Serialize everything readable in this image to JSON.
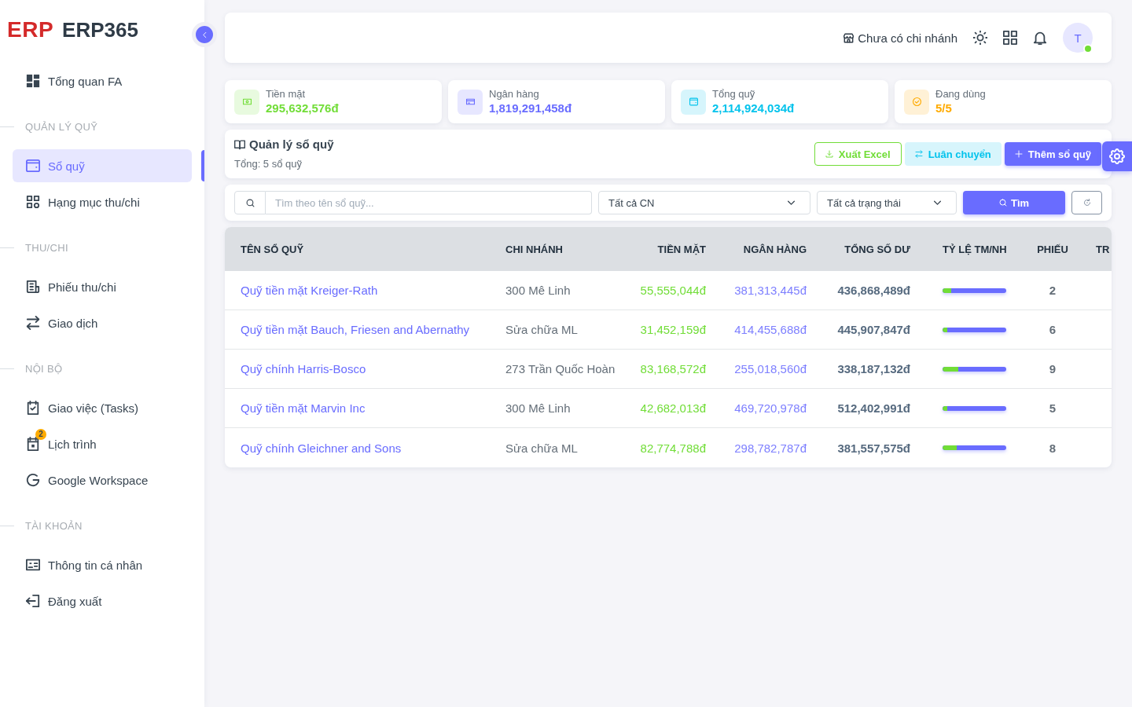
{
  "sidebar": {
    "logo": {
      "mark": "ERP",
      "name": "ERP365"
    },
    "nav": [
      {
        "kind": "link",
        "label": "Tổng quan FA",
        "selected": false
      },
      {
        "kind": "heading",
        "label": "QUẢN LÝ QUỸ"
      },
      {
        "kind": "link",
        "label": "Sổ quỹ",
        "selected": true
      },
      {
        "kind": "link",
        "label": "Hạng mục thu/chi",
        "selected": false
      },
      {
        "kind": "heading",
        "label": "THU/CHI"
      },
      {
        "kind": "link",
        "label": "Phiếu thu/chi",
        "selected": false
      },
      {
        "kind": "link",
        "label": "Giao dịch",
        "selected": false
      },
      {
        "kind": "heading",
        "label": "NỘI BỘ"
      },
      {
        "kind": "link",
        "label": "Giao việc (Tasks)",
        "selected": false
      },
      {
        "kind": "link",
        "label": "Lịch trình",
        "selected": false,
        "badge": "2"
      },
      {
        "kind": "link",
        "label": "Google Workspace",
        "selected": false
      },
      {
        "kind": "heading",
        "label": "TÀI KHOẢN"
      },
      {
        "kind": "link",
        "label": "Thông tin cá nhân",
        "selected": false
      },
      {
        "kind": "link",
        "label": "Đăng xuất",
        "selected": false
      }
    ]
  },
  "topbar": {
    "branch": "Chưa có chi nhánh",
    "avatar": {
      "initial": "T",
      "online": true
    }
  },
  "stats": [
    {
      "label": "Tiền mặt",
      "value": "295,632,576đ",
      "color": "#71dd37"
    },
    {
      "label": "Ngân hàng",
      "value": "1,819,291,458đ",
      "color": "#696cff"
    },
    {
      "label": "Tổng quỹ",
      "value": "2,114,924,034đ",
      "color": "#03c3ec"
    },
    {
      "label": "Đang dùng",
      "value": "5/5",
      "color": "#ffab00"
    }
  ],
  "fund_panel": {
    "title": "Quản lý sổ quỹ",
    "subtitle": "Tổng: 5 sổ quỹ",
    "actions": [
      {
        "kind": "outline",
        "label": "Xuất Excel"
      },
      {
        "kind": "soft",
        "label": "Luân chuyển"
      },
      {
        "kind": "primary",
        "label": "Thêm sổ quỹ"
      }
    ]
  },
  "filters": {
    "search": {
      "placeholder": "Tìm theo tên sổ quỹ..."
    },
    "selects": [
      {
        "value": "Tất cả CN"
      },
      {
        "value": "Tất cả trạng thái"
      }
    ],
    "search_button": "Tìm"
  },
  "table": {
    "columns": [
      "TÊN SỔ QUỸ",
      "CHI NHÁNH",
      "TIỀN MẶT",
      "NGÂN HÀNG",
      "TỔNG SỐ DƯ",
      "TỶ LỆ TM/NH",
      "PHIẾU",
      "TR"
    ],
    "rows": [
      {
        "name": "Quỹ tiền mặt Kreiger-Rath",
        "branch": "300 Mê Linh",
        "cash": "55,555,044đ",
        "bank": "381,313,445đ",
        "total": "436,868,489đ",
        "ratio": {
          "level": 0.13
        },
        "vouchers": "2"
      },
      {
        "name": "Quỹ tiền mặt Bauch, Friesen and Abernathy",
        "branch": "Sửa chữa ML",
        "cash": "31,452,159đ",
        "bank": "414,455,688đ",
        "total": "445,907,847đ",
        "ratio": {
          "level": 0.07
        },
        "vouchers": "6"
      },
      {
        "name": "Quỹ chính Harris-Bosco",
        "branch": "273 Trần Quốc Hoàn",
        "cash": "83,168,572đ",
        "bank": "255,018,560đ",
        "total": "338,187,132đ",
        "ratio": {
          "level": 0.25
        },
        "vouchers": "9"
      },
      {
        "name": "Quỹ tiền mặt Marvin Inc",
        "branch": "300 Mê Linh",
        "cash": "42,682,013đ",
        "bank": "469,720,978đ",
        "total": "512,402,991đ",
        "ratio": {
          "level": 0.08
        },
        "vouchers": "5"
      },
      {
        "name": "Quỹ chính Gleichner and Sons",
        "branch": "Sửa chữa ML",
        "cash": "82,774,788đ",
        "bank": "298,782,787đ",
        "total": "381,557,575đ",
        "ratio": {
          "level": 0.22
        },
        "vouchers": "8"
      }
    ]
  }
}
